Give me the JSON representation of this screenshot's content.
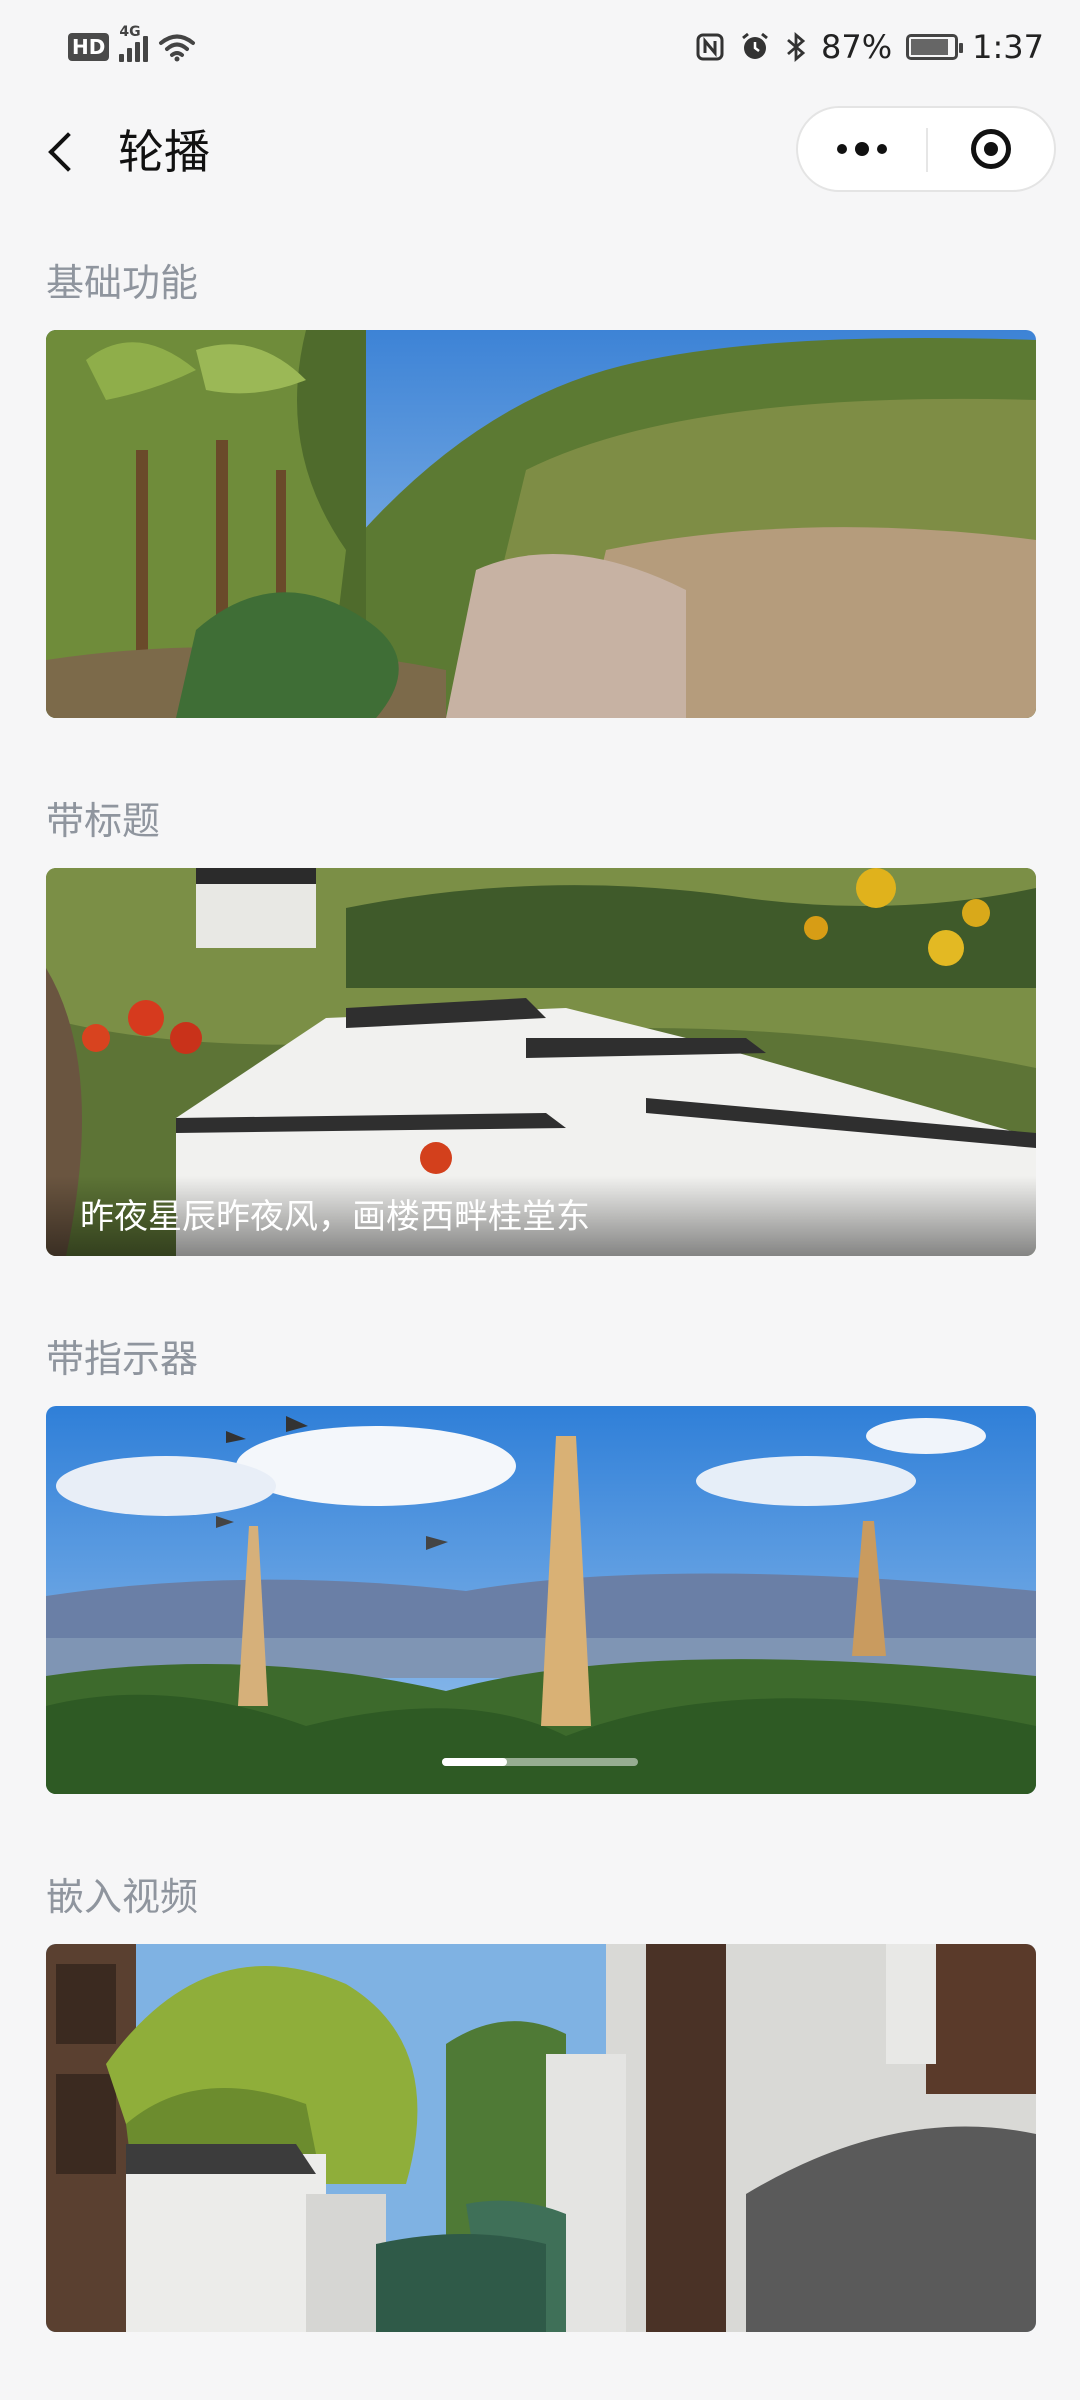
{
  "status_bar": {
    "hd": "HD",
    "network": "4G",
    "battery_text": "87%",
    "battery_level": 0.87,
    "time": "1:37"
  },
  "nav": {
    "title": "轮播"
  },
  "sections": [
    {
      "title": "基础功能"
    },
    {
      "title": "带标题",
      "caption": "昨夜星辰昨夜风，画楼西畔桂堂东"
    },
    {
      "title": "带指示器",
      "indicator_active_fraction": 0.33
    },
    {
      "title": "嵌入视频"
    }
  ],
  "colors": {
    "page_bg": "#f6f6f7",
    "section_title": "#8f959e",
    "nav_text": "#111111"
  }
}
